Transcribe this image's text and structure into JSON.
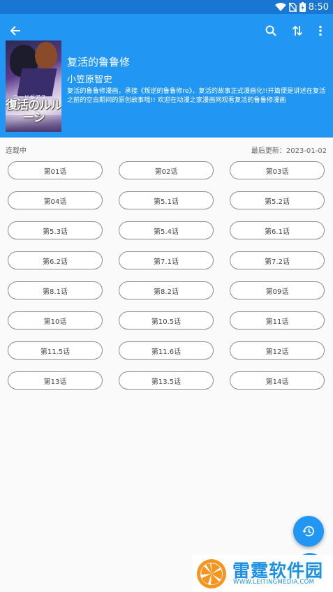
{
  "status_bar": {
    "time": "8:50"
  },
  "toolbar": {
    "back_icon": "arrow-left-icon",
    "search_icon": "search-icon",
    "sort_icon": "swap-vertical-icon",
    "more_icon": "more-vertical-icon"
  },
  "manga": {
    "cover_text": "復活のルルーシ",
    "cover_sub": "コードギアス",
    "title": "复活的鲁鲁修",
    "author": "小笠原智史",
    "description": "复活的鲁鲁修漫画，承接《叛逆的鲁鲁修re》，复活的故事正式漫画化!!开篇便是讲述在复活之前的空白期间的原创故事哦!! 欢迎在动漫之家漫画网观看复活的鲁鲁修漫画"
  },
  "info": {
    "status": "连载中",
    "last_update": "最后更新：2023-01-02"
  },
  "chapters": [
    "第01话",
    "第02话",
    "第03话",
    "第04话",
    "第5.1话",
    "第5.2话",
    "第5.3话",
    "第5.4话",
    "第6.1话",
    "第6.2话",
    "第7.1话",
    "第7.2话",
    "第8.1话",
    "第8.2话",
    "第09话",
    "第10话",
    "第10.5话",
    "第11话",
    "第11.5话",
    "第11.6话",
    "第12话",
    "第13话",
    "第13.5话",
    "第14话"
  ],
  "fab": {
    "icon": "history-icon"
  },
  "watermark": {
    "text": "雷霆软件园",
    "url": "WWW.LEITINGMEDIA.COM"
  },
  "colors": {
    "primary": "#2196f3",
    "status_bar": "#1976d2",
    "watermark": "#1e90e0",
    "logo": "#f7941d"
  }
}
